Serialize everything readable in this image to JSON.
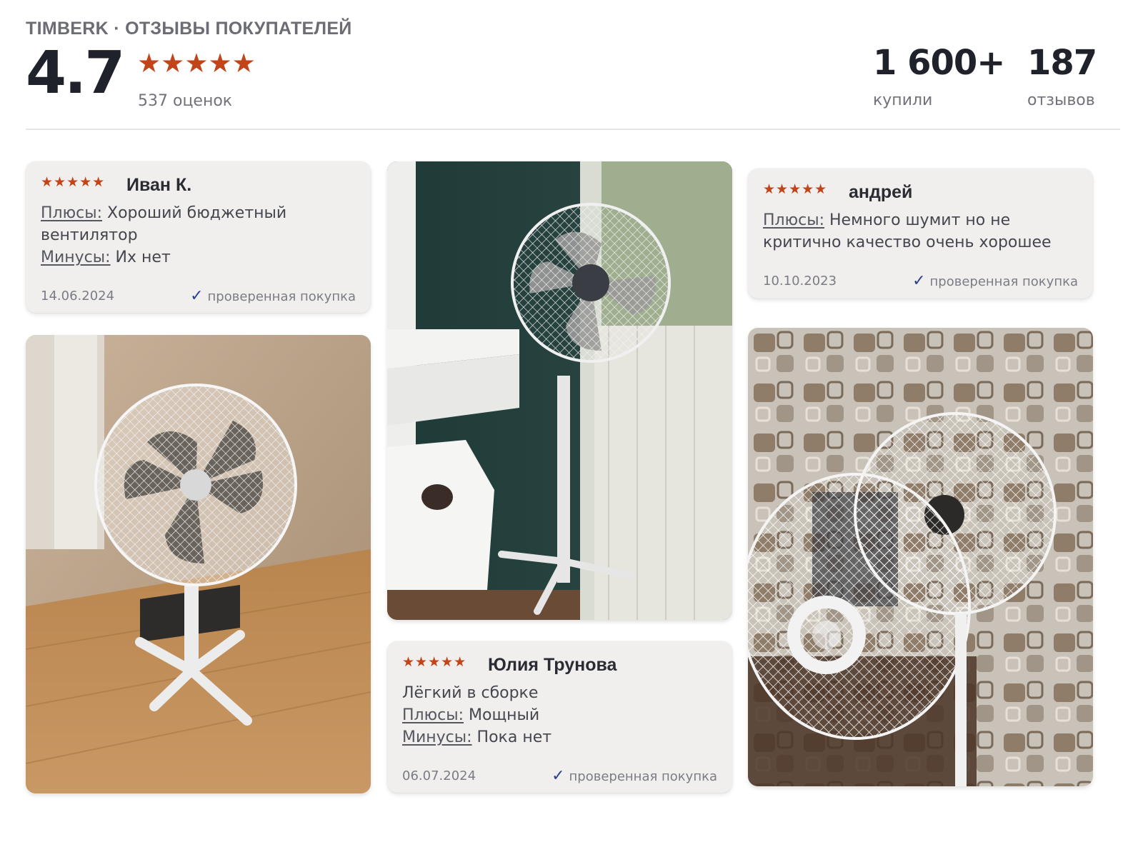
{
  "header": {
    "brand_line": "TIMBERK · ОТЗЫВЫ ПОКУПАТЕЛЕЙ",
    "rating": "4.7",
    "rating_stars": 5,
    "ratings_count": "537 оценок",
    "bought_value": "1 600+",
    "bought_label": "купили",
    "reviews_value": "187",
    "reviews_label": "отзывов"
  },
  "star_color": "#c2451a",
  "reviews": [
    {
      "stars": "★★★★★",
      "author": "Иван К.",
      "pros_label": "Плюсы:",
      "pros": " Хороший бюджетный вентилятор",
      "cons_label": "Минусы:",
      "cons": " Их нет",
      "date": "14.06.2024",
      "verified": "проверенная покупка"
    },
    {
      "stars": "★★★★★",
      "author": "андрей",
      "pros_label": "Плюсы:",
      "pros": " Немного шумит но не критично качество очень хорошее",
      "date": "10.10.2023",
      "verified": "проверенная покупка"
    },
    {
      "stars": "★★★★★",
      "author": "Юлия Трунова",
      "comment": "Лёгкий в сборке",
      "pros_label": "Плюсы:",
      "pros": " Мощный",
      "cons_label": "Минусы:",
      "cons": " Пока нет",
      "date": "06.07.2024",
      "verified": "проверенная покупка"
    }
  ],
  "check_icon": "✓"
}
